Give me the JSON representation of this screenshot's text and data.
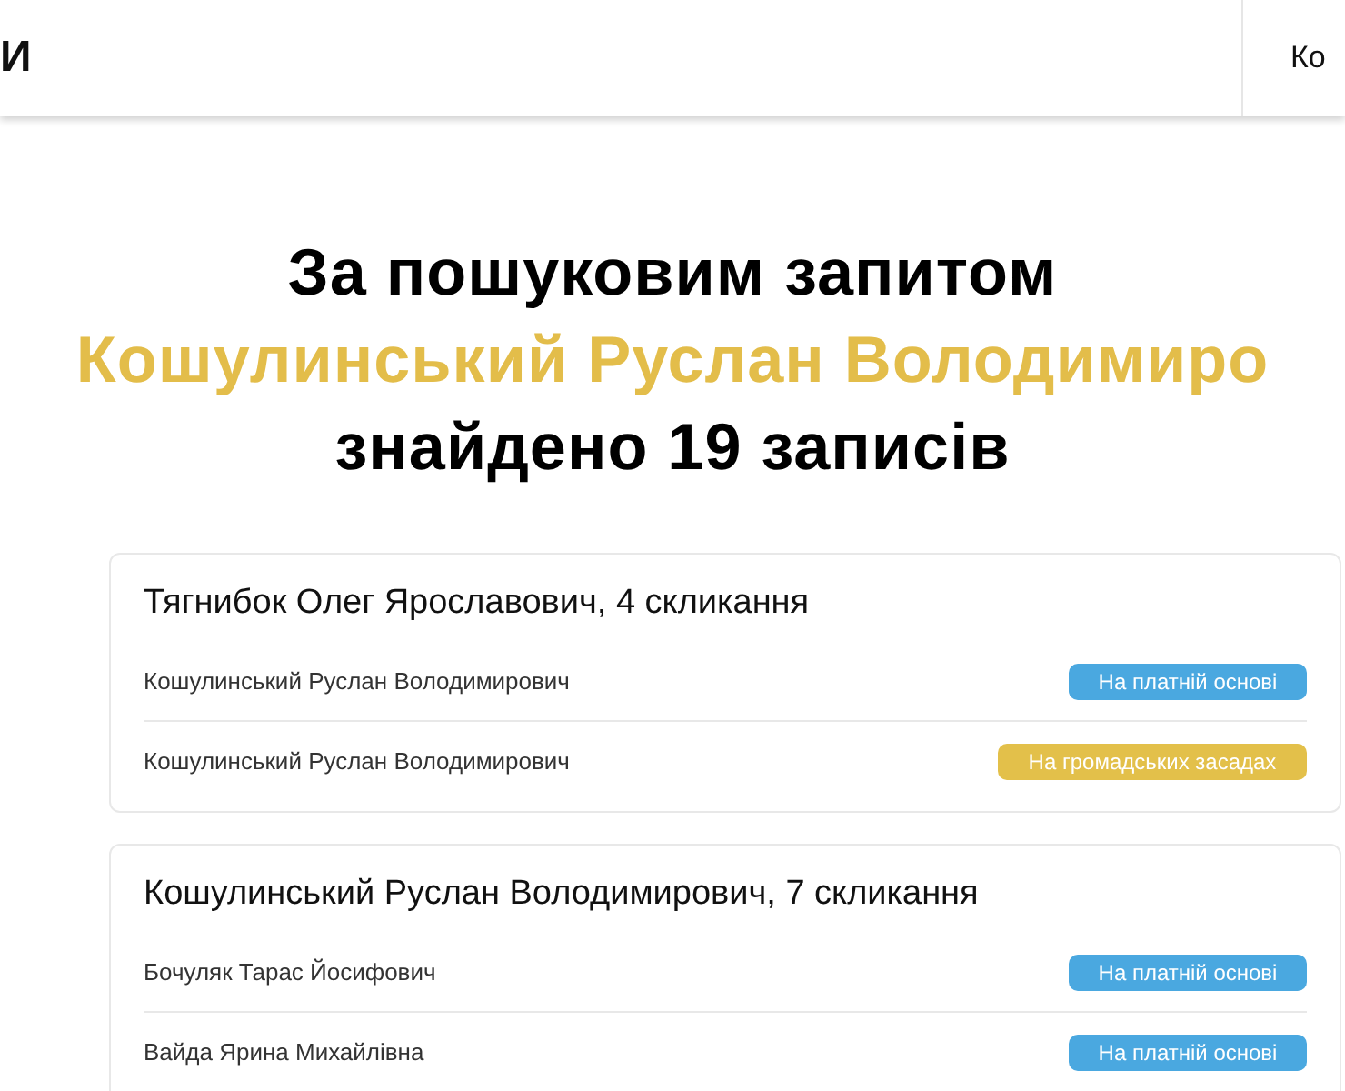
{
  "header": {
    "logo": "И",
    "nav_item": "Ко"
  },
  "heading": {
    "line_1": "За пошуковим запитом",
    "query": "Кошулинський Руслан Володимиро",
    "line_3": "знайдено 19 записів"
  },
  "results": [
    {
      "title": "Тягнибок Олег Ярославович, 4 скликання",
      "rows": [
        {
          "name": "Кошулинський Руслан Володимирович",
          "badge": {
            "text": "На платній основі",
            "kind": "paid"
          }
        },
        {
          "name": "Кошулинський Руслан Володимирович",
          "badge": {
            "text": "На громадських засадах",
            "kind": "volunteer"
          }
        }
      ]
    },
    {
      "title": "Кошулинський Руслан Володимирович, 7 скликання",
      "rows": [
        {
          "name": "Бочуляк Тарас Йосифович",
          "badge": {
            "text": "На платній основі",
            "kind": "paid"
          }
        },
        {
          "name": "Вайда Ярина Михайлівна",
          "badge": {
            "text": "На платній основі",
            "kind": "paid"
          }
        }
      ]
    }
  ]
}
